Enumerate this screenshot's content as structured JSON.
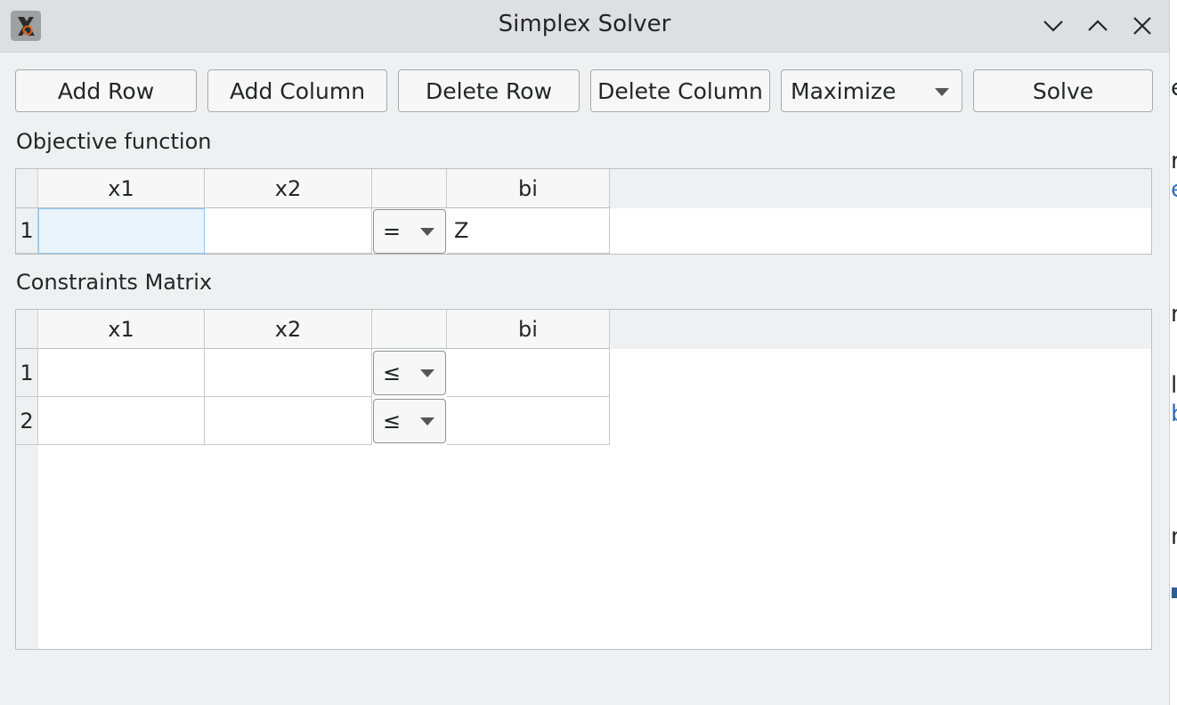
{
  "window": {
    "title": "Simplex Solver",
    "icons": {
      "app": "app-icon",
      "minimize": "chevron-down-icon",
      "maximize": "chevron-up-icon",
      "close": "close-icon"
    }
  },
  "toolbar": {
    "add_row": "Add Row",
    "add_column": "Add Column",
    "delete_row": "Delete Row",
    "delete_column": "Delete Column",
    "mode": "Maximize",
    "solve": "Solve"
  },
  "objective": {
    "label": "Objective function",
    "headers": [
      "x1",
      "x2",
      "",
      "bi"
    ],
    "rows": [
      {
        "index": "1",
        "x1": "",
        "x2": "",
        "sign": "=",
        "bi": "Z"
      }
    ]
  },
  "constraints": {
    "label": "Constraints Matrix",
    "headers": [
      "x1",
      "x2",
      "",
      "bi"
    ],
    "rows": [
      {
        "index": "1",
        "x1": "",
        "x2": "",
        "sign": "≤",
        "bi": ""
      },
      {
        "index": "2",
        "x1": "",
        "x2": "",
        "sign": "≤",
        "bi": ""
      }
    ]
  },
  "colors": {
    "titlebar": "#dedfe0",
    "window_bg": "#eff0f1",
    "selection": "#eaf4fb",
    "selection_border": "#90c8f0",
    "link": "#2f6fb7"
  }
}
